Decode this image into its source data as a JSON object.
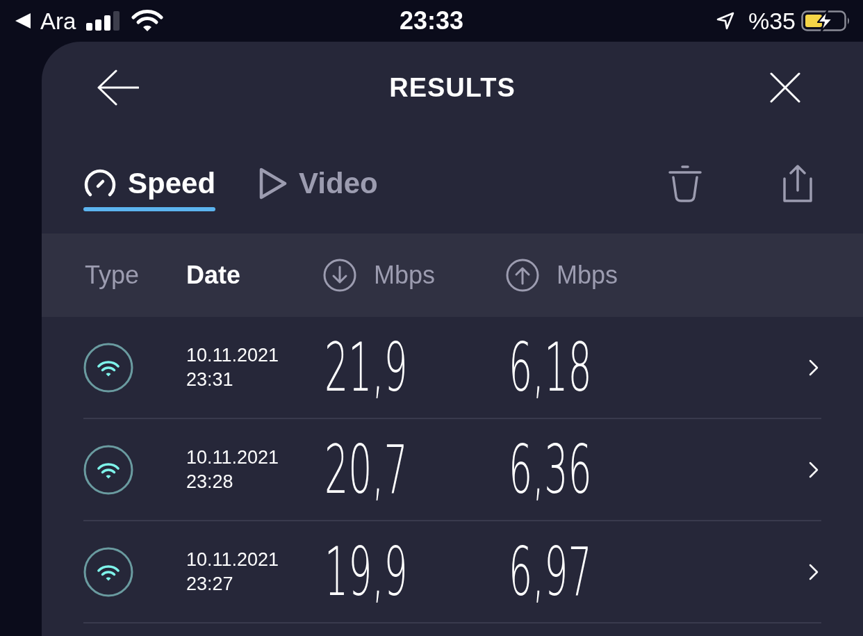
{
  "status_bar": {
    "back_label": "Ara",
    "time": "23:33",
    "battery_percent": "%35"
  },
  "header": {
    "title": "RESULTS"
  },
  "tabs": [
    {
      "kind": "speed",
      "label": "Speed",
      "selected": true
    },
    {
      "kind": "video",
      "label": "Video",
      "selected": false
    }
  ],
  "table": {
    "columns": [
      {
        "kind": "type",
        "label": "Type",
        "selected": false
      },
      {
        "kind": "date",
        "label": "Date",
        "selected": true
      },
      {
        "kind": "download",
        "label": "Mbps",
        "selected": false
      },
      {
        "kind": "upload",
        "label": "Mbps",
        "selected": false
      }
    ],
    "rows": [
      {
        "kind": "wifi",
        "date": "10.11.2021",
        "time": "23:31",
        "download": "21,9",
        "upload": "6,18"
      },
      {
        "kind": "wifi",
        "date": "10.11.2021",
        "time": "23:28",
        "download": "20,7",
        "upload": "6,36"
      },
      {
        "kind": "wifi",
        "date": "10.11.2021",
        "time": "23:27",
        "download": "19,9",
        "upload": "6,97"
      }
    ]
  }
}
